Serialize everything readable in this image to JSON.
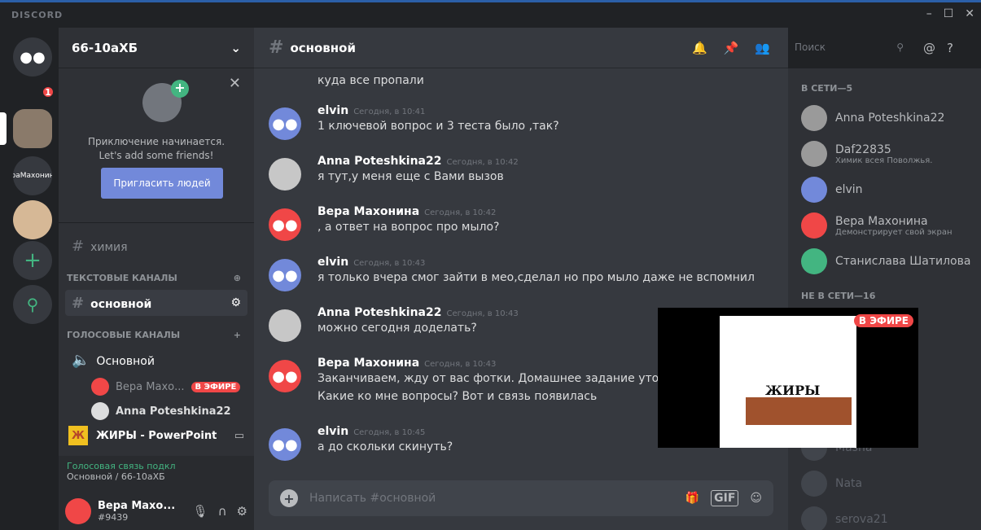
{
  "titlebar": {
    "brand": "DISCORD",
    "minimize": "–",
    "maximize": "☐",
    "close": "✕"
  },
  "rail": {
    "home_badge": "1",
    "server2_label": "раМахонин",
    "add_icon": "+",
    "explore_icon": "⚲"
  },
  "guild": {
    "name": "66-10аХБ",
    "chevron": "⌄"
  },
  "invite": {
    "line1": "Приключение начинается.",
    "line2": "Let's add some friends!",
    "button": "Пригласить людей"
  },
  "channels": {
    "top_channel": "химия",
    "text_category": "ТЕКСТОВЫЕ КАНАЛЫ",
    "active_channel": "основной",
    "voice_category": "ГОЛОСОВЫЕ КАНАЛЫ",
    "voice_channel": "Основной",
    "voice_users": [
      {
        "name": "Вера Махо...",
        "badge": "В ЭФИРЕ"
      },
      {
        "name": "Anna Poteshkina22"
      }
    ]
  },
  "screenshare": {
    "title": "ЖИРЫ - PowerPoint"
  },
  "voice_status": {
    "status": "Голосовая связь подкл",
    "location": "Основной / 66-10аХБ"
  },
  "user": {
    "name": "Вера Махо...",
    "tag": "#9439"
  },
  "chat": {
    "channel": "основной",
    "search_placeholder": "Поиск",
    "composer_placeholder": "Написать #основной",
    "gif": "GIF",
    "messages": [
      {
        "author": "",
        "time": "",
        "text": "куда все пропали"
      },
      {
        "author": "elvin",
        "time": "Сегодня, в 10:41",
        "text": "1 ключевой вопрос и 3 теста было ,так?"
      },
      {
        "author": "Anna Poteshkina22",
        "time": "Сегодня, в 10:42",
        "text": "я тут,у меня еще с Вами вызов"
      },
      {
        "author": "Вера Махонина",
        "time": "Сегодня, в 10:42",
        "text": ", а ответ на вопрос про мыло?"
      },
      {
        "author": "elvin",
        "time": "Сегодня, в 10:43",
        "text": "я только вчера смог зайти  в мео,сделал но про мыло даже не вспомнил"
      },
      {
        "author": "Anna Poteshkina22",
        "time": "Сегодня, в 10:43",
        "text": "можно сегодня доделать?"
      },
      {
        "author": "Вера Махонина",
        "time": "Сегодня, в 10:43",
        "text": "Заканчиваем, жду от вас фотки. Домашнее задание уточню",
        "text2": "Какие ко мне вопросы? Вот и связь появилась"
      },
      {
        "author": "elvin",
        "time": "Сегодня, в 10:45",
        "text": "а до скольки скинуть?"
      }
    ]
  },
  "members": {
    "online_header": "В СЕТИ—5",
    "online": [
      {
        "name": "Anna Poteshkina22",
        "sub": ""
      },
      {
        "name": "Daf22835",
        "sub": "Химик всея Поволжья."
      },
      {
        "name": "elvin",
        "sub": ""
      },
      {
        "name": "Вера Махонина",
        "sub": "Демонстрирует свой экран"
      },
      {
        "name": "Станислава Шатилова",
        "sub": ""
      }
    ],
    "offline_header": "НЕ В СЕТИ—16",
    "offline": [
      "Masha",
      "Nata",
      "serova21"
    ]
  },
  "stream": {
    "live": "В ЭФИРЕ",
    "slide_title": "ЖИРЫ"
  }
}
